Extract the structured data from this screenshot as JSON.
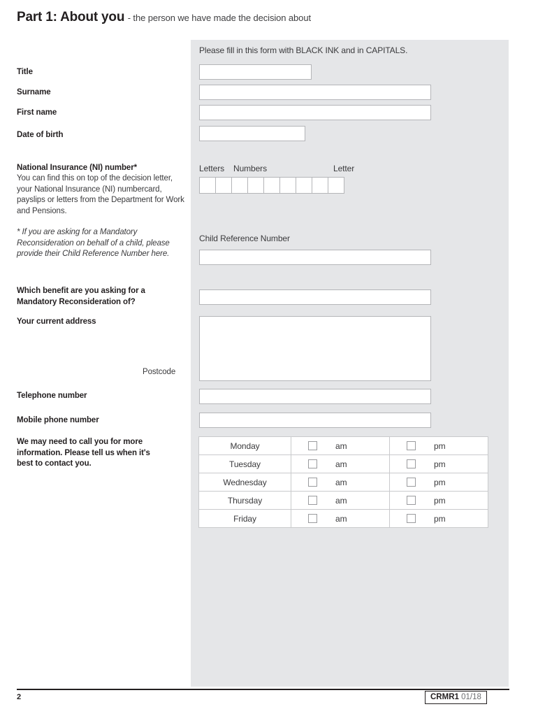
{
  "header": {
    "title": "Part 1: About you",
    "subtitle": "- the person we have made the decision about"
  },
  "panel": {
    "instruction": "Please fill in this form with BLACK INK and in CAPITALS."
  },
  "fields": {
    "title": {
      "label": "Title",
      "value": "",
      "placeholder": ""
    },
    "surname": {
      "label": "Surname",
      "value": "",
      "placeholder": ""
    },
    "first_name": {
      "label": "First name",
      "value": "",
      "placeholder": ""
    },
    "date_of_birth": {
      "label": "Date of birth",
      "value": "",
      "placeholder": ""
    },
    "ni_number": {
      "label": "National Insurance (NI) number*",
      "help": "You can find this on top of the decision letter, your National Insurance (NI) numbercard, payslips or letters from the Department for Work and Pensions.",
      "footnote": "* If you are asking for a Mandatory Reconsideration on behalf of a child, please provide their Child Reference Number here.",
      "group_letters": "Letters",
      "group_numbers": "Numbers",
      "group_letter": "Letter",
      "box_count": 9,
      "values": [
        "",
        "",
        "",
        "",
        "",
        "",
        "",
        "",
        ""
      ]
    },
    "child_reference_number": {
      "label": "Child Reference Number",
      "value": "",
      "placeholder": ""
    },
    "benefit": {
      "label_line1": "Which benefit are you asking for a",
      "label_line2": "Mandatory Reconsideration of?",
      "value": ""
    },
    "address": {
      "label": "Your current address",
      "value": ""
    },
    "postcode": {
      "label": "Postcode",
      "value": ""
    },
    "telephone": {
      "label": "Telephone number",
      "value": "",
      "placeholder": ""
    },
    "mobile": {
      "label": "Mobile phone number",
      "value": "",
      "placeholder": ""
    }
  },
  "contact_times": {
    "label_line1": "We may need to call you for more",
    "label_line2": "information. Please tell us when it's",
    "label_line3": "best to contact you.",
    "slot_labels": [
      "am",
      "pm"
    ],
    "rows": [
      {
        "day": "Monday",
        "am_checked": false,
        "pm_checked": false
      },
      {
        "day": "Tuesday",
        "am_checked": false,
        "pm_checked": false
      },
      {
        "day": "Wednesday",
        "am_checked": false,
        "pm_checked": false
      },
      {
        "day": "Thursday",
        "am_checked": false,
        "pm_checked": false
      },
      {
        "day": "Friday",
        "am_checked": false,
        "pm_checked": false
      }
    ]
  },
  "footer": {
    "page_number": "2",
    "form_code": "CRMR1",
    "form_version": "01/18"
  },
  "colors": {
    "panel_background": "#e5e6e8",
    "field_border": "#b4b5b8",
    "text": "#231f20",
    "muted_text": "#3a3a3c",
    "page_background": "#ffffff"
  }
}
